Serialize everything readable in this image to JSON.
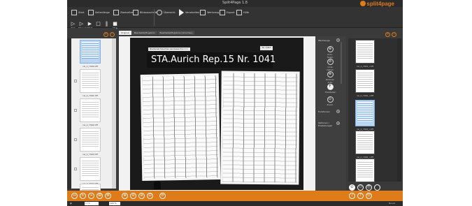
{
  "window": {
    "title": "Split4Page 1.8",
    "brand": "split4page",
    "controls": "–  □  ✕"
  },
  "ribbon": {
    "buttons": [
      {
        "label": "Start",
        "icon": "start-icon"
      },
      {
        "label": "Seitenlänge",
        "icon": "page-length-icon"
      },
      {
        "label": "Zweiseiten",
        "icon": "two-pages-icon"
      },
      {
        "label": "Bildausschnitt",
        "icon": "image-crop-icon"
      },
      {
        "label": "Übersicht",
        "icon": "overview-icon"
      },
      {
        "label": "Verarbeiten",
        "icon": "process-icon"
      },
      {
        "label": "Werkzeug",
        "icon": "tool-icon"
      },
      {
        "label": "Export",
        "icon": "export-icon"
      },
      {
        "label": "Hilfe",
        "icon": "help-icon"
      }
    ],
    "playback": [
      {
        "glyph": "▷",
        "label": "Test"
      },
      {
        "glyph": "▷",
        "label": "Manuell"
      },
      {
        "glyph": "▶",
        "label": "Start"
      },
      {
        "glyph": "□",
        "label": ""
      },
      {
        "glyph": "‖",
        "label": ""
      },
      {
        "glyph": "■",
        "label": "Stop"
      }
    ]
  },
  "tabs": [
    {
      "label": "Original"
    },
    {
      "label": "Bearbeitet/Ergebnis"
    },
    {
      "label": "Bearbeitet/Ergebnis (Vorschau)"
    }
  ],
  "document": {
    "archive_label": "STA.Aurich Rep.15  Nr. 1041",
    "small_label": "Niedersächsisches Landesarchiv  1  1  —  4",
    "small_label_right": "Nr. 1041"
  },
  "left_thumbs": [
    {
      "caption": "rel_2_7990.tiff",
      "selected": true
    },
    {
      "caption": "rel_2_7991.tiff",
      "selected": false
    },
    {
      "caption": "rel_2_7992.tiff",
      "selected": false
    },
    {
      "caption": "rel_2_7993.tiff",
      "selected": false
    },
    {
      "caption": "rel_2_7994.tiff",
      "selected": false
    },
    {
      "caption": "rel_2_7995.tiff",
      "selected": false
    }
  ],
  "right_thumbs": [
    {
      "caption": "rel_2_7991_l.tiff",
      "selected": false
    },
    {
      "caption": "rel_2_7991_r.tiff",
      "selected": false
    },
    {
      "caption": "rel_2_7992_l.tiff",
      "selected": true
    },
    {
      "caption": "rel_2_7992_r.tiff",
      "selected": false
    },
    {
      "caption": "rel_2_7993_l.tiff",
      "selected": false
    }
  ],
  "tools_panel": {
    "section1": "Werkzeuge",
    "tools": [
      {
        "glyph": "⊕",
        "label": "Auto-Teilen"
      },
      {
        "glyph": "⊘",
        "label": "Linie ziehen"
      },
      {
        "glyph": "⊗",
        "label": "Rahmen Auto"
      },
      {
        "glyph": "F",
        "label": "Freistellen"
      },
      {
        "glyph": "⊙",
        "label": "Zoom"
      }
    ],
    "section2": "Funktionen",
    "section3": "Optionen / Einstellungen"
  },
  "bottom": {
    "zoom_icons": [
      "⊕",
      "⊖",
      "⊘",
      "⊡"
    ],
    "page_text": "1 / 1",
    "zoom_text": "100 %",
    "status_right": "Bereit"
  }
}
